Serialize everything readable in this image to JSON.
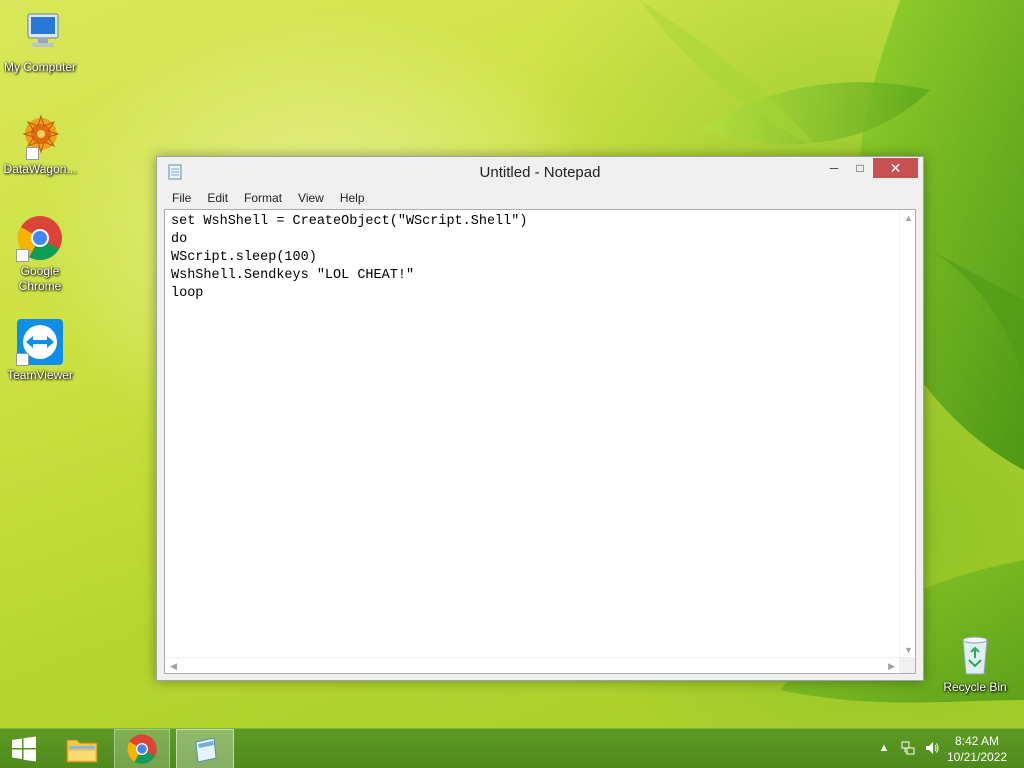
{
  "desktop": {
    "icons": [
      {
        "label": "My Computer"
      },
      {
        "label": "DataWagon..."
      },
      {
        "label": "Google Chrome"
      },
      {
        "label": "TeamViewer"
      },
      {
        "label": "Recycle Bin"
      }
    ]
  },
  "window": {
    "title": "Untitled - Notepad",
    "controls": {
      "minimize": "─",
      "maximize": "□",
      "close": "✕"
    },
    "menu": [
      "File",
      "Edit",
      "Format",
      "View",
      "Help"
    ],
    "content": "set WshShell = CreateObject(\"WScript.Shell\")\ndo\nWScript.sleep(100)\nWshShell.Sendkeys \"LOL CHEAT!\"\nloop"
  },
  "taskbar": {
    "time": "8:42 AM",
    "date": "10/21/2022"
  },
  "colors": {
    "taskbar": "#5d9a24",
    "close_button": "#c75050",
    "wallpaper_base": "#cbe040"
  }
}
